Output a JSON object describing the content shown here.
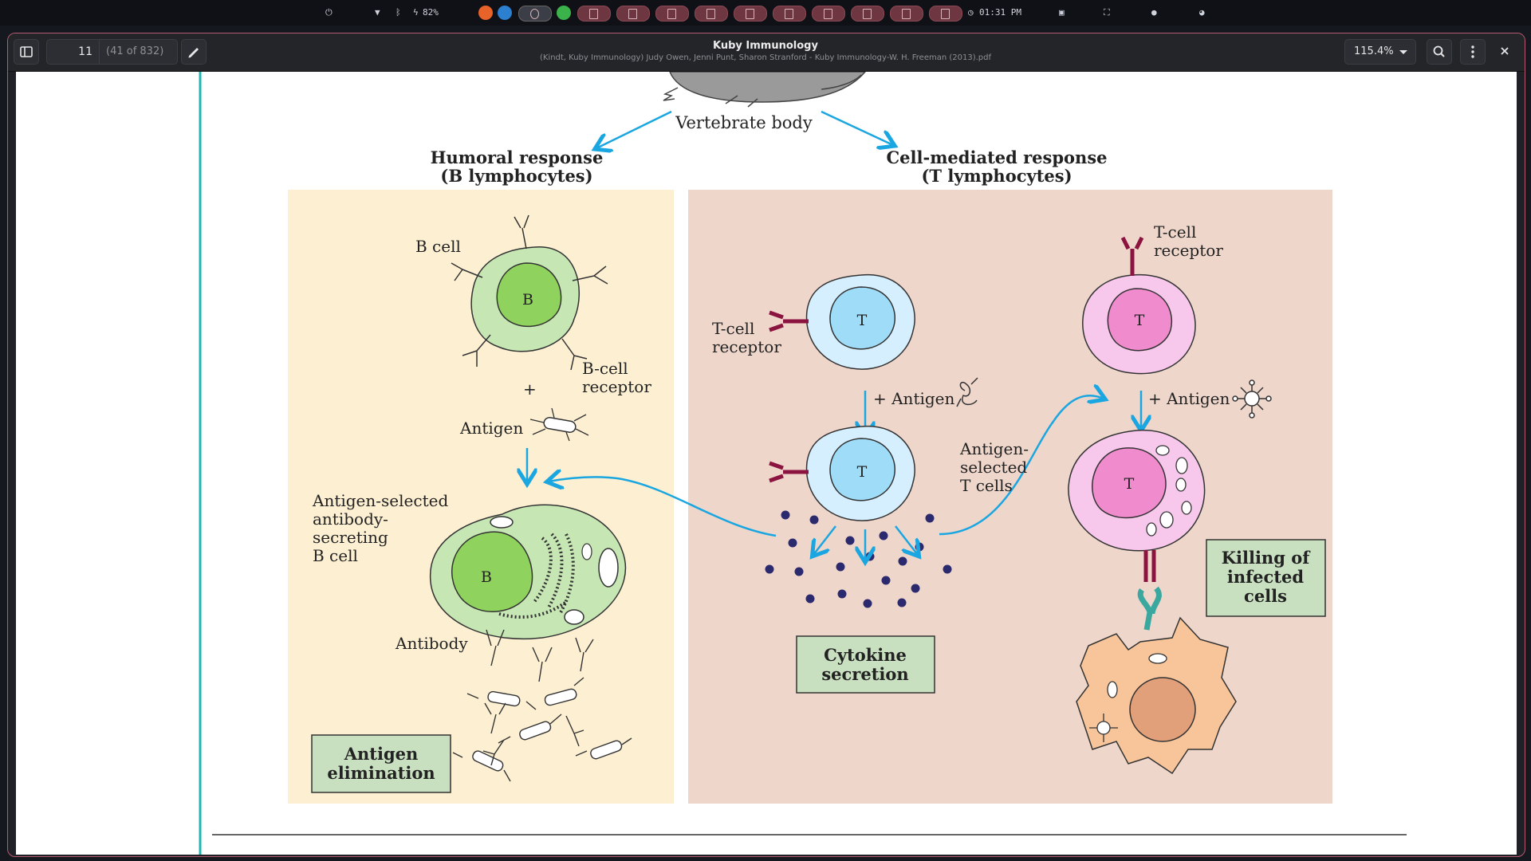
{
  "system_bar": {
    "battery": "82%",
    "clock": "01:31 PM"
  },
  "viewer": {
    "page_number": "11",
    "page_total": "(41 of 832)",
    "title": "Kuby Immunology",
    "subtitle": "(Kindt, Kuby Immunology) Judy Owen, Jenni Punt, Sharon Stranford - Kuby Immunology-W. H. Freeman (2013).pdf",
    "zoom": "115.4%"
  },
  "figure": {
    "top_label": "Vertebrate body",
    "humoral": {
      "heading_line1": "Humoral response",
      "heading_line2": "(B lymphocytes)",
      "b_cell_label": "B cell",
      "b_letter": "B",
      "bcr_line1": "B-cell",
      "bcr_line2": "receptor",
      "plus": "+",
      "antigen": "Antigen",
      "selected_line1": "Antigen-selected",
      "selected_line2": "antibody-",
      "selected_line3": "secreting",
      "selected_line4": "B cell",
      "antibody": "Antibody",
      "box_line1": "Antigen",
      "box_line2": "elimination"
    },
    "cell_mediated": {
      "heading_line1": "Cell-mediated response",
      "heading_line2": "(T lymphocytes)",
      "t_letter": "T",
      "tcr1_line1": "T-cell",
      "tcr1_line2": "receptor",
      "tcr2_line1": "T-cell",
      "tcr2_line2": "receptor",
      "plus_antigen": "+ Antigen",
      "selected_line1": "Antigen-",
      "selected_line2": "selected",
      "selected_line3": "T cells",
      "cytokine_line1": "Cytokine",
      "cytokine_line2": "secretion",
      "killing_line1": "Killing of",
      "killing_line2": "infected",
      "killing_line3": "cells"
    }
  },
  "colors": {
    "humoral_bg": "#fdefd2",
    "cell_bg": "#eed6cb",
    "arrow": "#1aa6e0",
    "box_fill": "#c8e0c0",
    "teal_rule": "#1fb7b3"
  }
}
